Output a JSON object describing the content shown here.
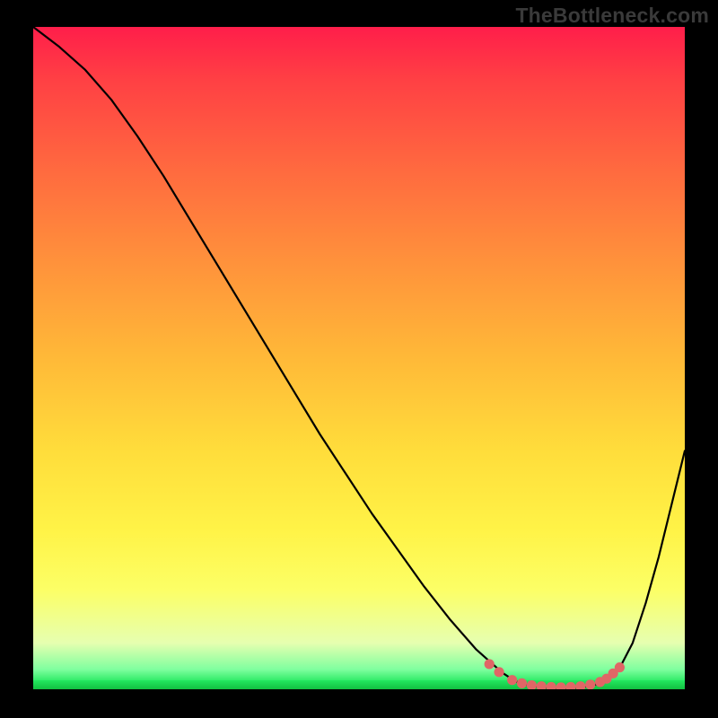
{
  "watermark": "TheBottleneck.com",
  "chart_data": {
    "type": "line",
    "title": "",
    "xlabel": "",
    "ylabel": "",
    "xlim": [
      0,
      100
    ],
    "ylim": [
      0,
      100
    ],
    "background_gradient": {
      "from": "top",
      "stops": [
        {
          "pos": 0,
          "color": "#ff1e4a"
        },
        {
          "pos": 50,
          "color": "#ffdd3b"
        },
        {
          "pos": 100,
          "color": "#16cc47"
        }
      ]
    },
    "series": [
      {
        "name": "bottleneck-curve",
        "x": [
          0,
          4,
          8,
          12,
          16,
          20,
          24,
          28,
          32,
          36,
          40,
          44,
          48,
          52,
          56,
          60,
          64,
          68,
          72,
          74,
          76,
          78,
          80,
          82,
          84,
          86,
          88,
          90,
          92,
          94,
          96,
          98,
          100
        ],
        "y": [
          100,
          97,
          93.5,
          89,
          83.5,
          77.5,
          71,
          64.5,
          58,
          51.5,
          45,
          38.5,
          32.5,
          26.5,
          21,
          15.5,
          10.5,
          6,
          2.5,
          1.2,
          0.6,
          0.3,
          0.2,
          0.2,
          0.3,
          0.6,
          1.3,
          3.2,
          7,
          13,
          20,
          28,
          36
        ]
      }
    ],
    "markers": {
      "name": "low-range-markers",
      "color": "#e06666",
      "points": [
        {
          "x": 70,
          "y": 3.8
        },
        {
          "x": 71.5,
          "y": 2.6
        },
        {
          "x": 73.5,
          "y": 1.4
        },
        {
          "x": 75,
          "y": 0.9
        },
        {
          "x": 76.5,
          "y": 0.6
        },
        {
          "x": 78,
          "y": 0.45
        },
        {
          "x": 79.5,
          "y": 0.35
        },
        {
          "x": 81,
          "y": 0.3
        },
        {
          "x": 82.5,
          "y": 0.35
        },
        {
          "x": 84,
          "y": 0.45
        },
        {
          "x": 85.5,
          "y": 0.7
        },
        {
          "x": 87,
          "y": 1.1
        },
        {
          "x": 88,
          "y": 1.6
        },
        {
          "x": 89,
          "y": 2.4
        },
        {
          "x": 90,
          "y": 3.3
        }
      ]
    }
  }
}
